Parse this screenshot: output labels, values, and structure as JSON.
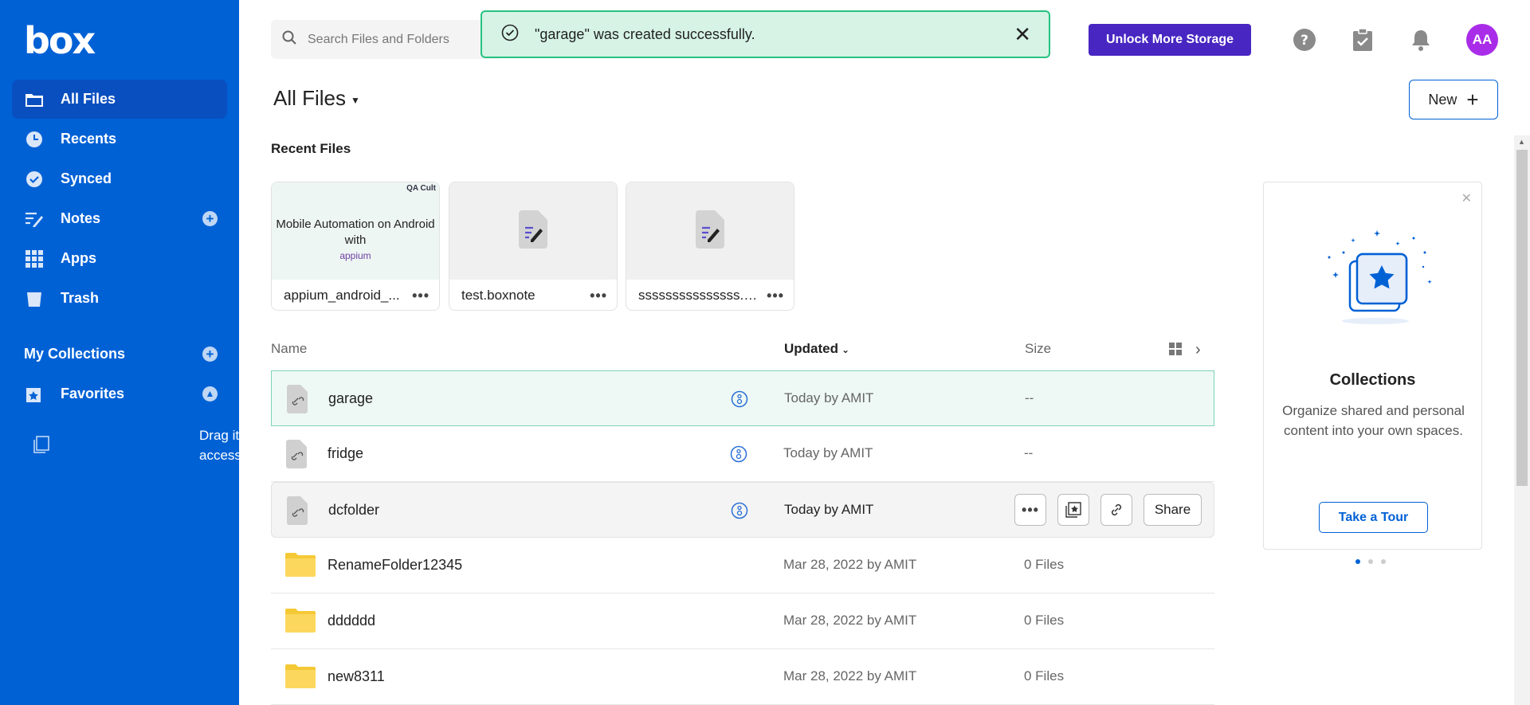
{
  "brand": {
    "logo": "box"
  },
  "sidebar": {
    "items": [
      {
        "label": "All Files",
        "icon": "folder-icon",
        "active": true
      },
      {
        "label": "Recents",
        "icon": "clock-icon"
      },
      {
        "label": "Synced",
        "icon": "check-circle-icon"
      },
      {
        "label": "Notes",
        "icon": "notes-icon",
        "has_add": true
      },
      {
        "label": "Apps",
        "icon": "apps-grid-icon"
      },
      {
        "label": "Trash",
        "icon": "trash-icon"
      }
    ],
    "collections_label": "My Collections",
    "favorites_label": "Favorites",
    "drag_hint": "Drag items here for quick access"
  },
  "header": {
    "search_placeholder": "Search Files and Folders",
    "unlock_label": "Unlock More Storage",
    "avatar_initials": "AA"
  },
  "toast": {
    "message": "\"garage\" was created successfully.",
    "close": "✕"
  },
  "main": {
    "title": "All Files",
    "new_label": "New",
    "recent_heading": "Recent Files",
    "recent_files": [
      {
        "name": "appium_android_...",
        "thumb_title": "Mobile Automation on Android with",
        "thumb_brand": "appium",
        "thumb_banner": "QA Cult"
      },
      {
        "name": "test.boxnote"
      },
      {
        "name": "sssssssssssssss.b..."
      }
    ],
    "columns": {
      "name": "Name",
      "updated": "Updated",
      "size": "Size"
    },
    "rows": [
      {
        "name": "garage",
        "updated": "Today by AMIT",
        "size": "--",
        "type": "bookmark",
        "state": "selected"
      },
      {
        "name": "fridge",
        "updated": "Today by AMIT",
        "size": "--",
        "type": "bookmark"
      },
      {
        "name": "dcfolder",
        "updated": "Today by AMIT",
        "size": "",
        "type": "bookmark",
        "state": "hover"
      },
      {
        "name": "RenameFolder12345",
        "updated": "Mar 28, 2022 by AMIT",
        "size": "0 Files",
        "type": "folder"
      },
      {
        "name": "dddddd",
        "updated": "Mar 28, 2022 by AMIT",
        "size": "0 Files",
        "type": "folder"
      },
      {
        "name": "new8311",
        "updated": "Mar 28, 2022 by AMIT",
        "size": "0 Files",
        "type": "folder"
      }
    ],
    "row_actions": {
      "share_label": "Share"
    }
  },
  "promo": {
    "heading": "Collections",
    "description": "Organize shared and personal content into your own spaces.",
    "tour_label": "Take a Tour"
  },
  "colors": {
    "sidebar": "#0061d5",
    "unlock": "#4826c2",
    "avatar": "#a92de8",
    "toast_bg": "#d6f3e6",
    "toast_border": "#26c281",
    "folder": "#fcd75e"
  }
}
